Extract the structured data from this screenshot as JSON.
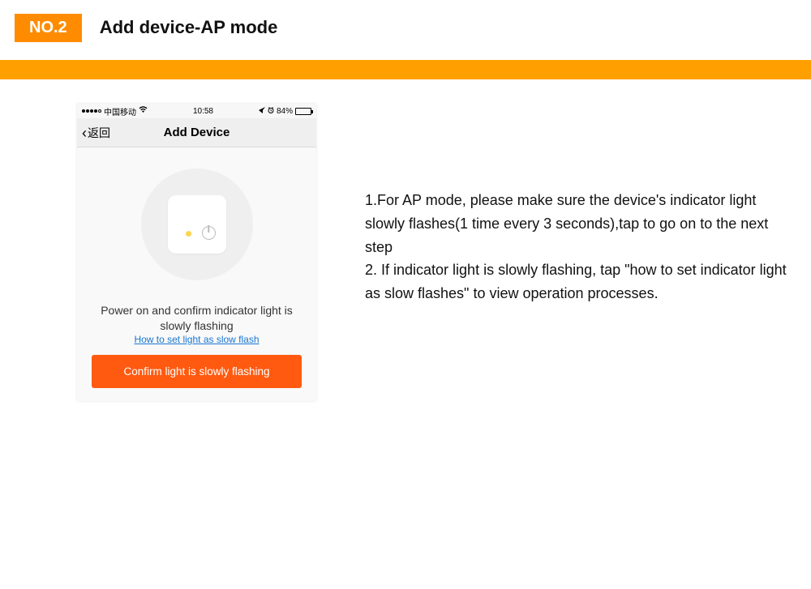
{
  "header": {
    "tag": "NO.2",
    "title": "Add device-AP mode"
  },
  "phone": {
    "status": {
      "carrier": "中国移动",
      "time": "10:58",
      "battery_pct": "84%"
    },
    "nav": {
      "back": "返回",
      "title": "Add Device"
    },
    "instruction": "Power on and confirm indicator light is slowly flashing",
    "help_link": "How to set light as slow flash",
    "confirm_button": "Confirm light is slowly flashing"
  },
  "instructions": {
    "line1": "1.For AP mode, please make sure the device's indicator light slowly flashes(1 time every 3 seconds),tap to go on to the next step",
    "line2": "2. If indicator light is slowly flashing, tap \"how to set indicator light as slow flashes\" to view operation processes."
  }
}
